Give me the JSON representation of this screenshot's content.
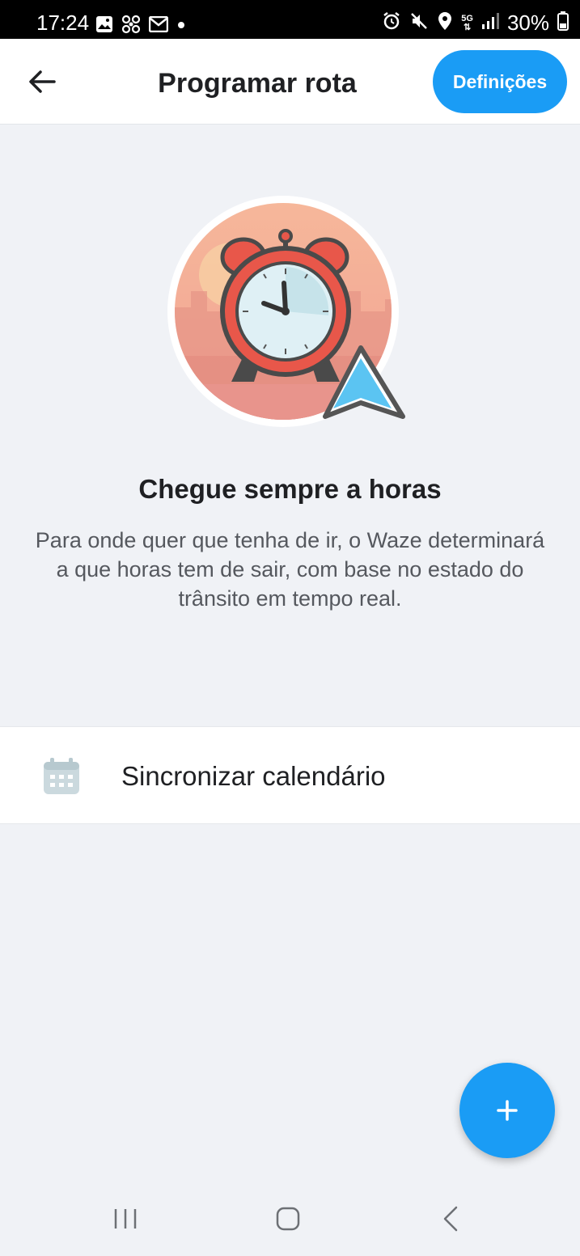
{
  "status_bar": {
    "time": "17:24",
    "battery": "30%",
    "left_icons": [
      "image-icon",
      "fan-icon",
      "mail-icon",
      "dot-icon"
    ],
    "right_icons": [
      "alarm-icon",
      "mute-icon",
      "location-icon",
      "5g-icon",
      "signal-icon",
      "battery-icon"
    ],
    "network_label": "5G"
  },
  "header": {
    "title": "Programar rota",
    "back_icon": "arrow-left-icon",
    "settings_label": "Definições"
  },
  "hero": {
    "illustration": "alarm-clock-navigation-illustration",
    "headline": "Chegue sempre a horas",
    "description": "Para onde quer que tenha de ir, o Waze determinará a que horas tem de sair, com base no estado do trânsito em tempo real."
  },
  "calendar_sync": {
    "icon": "calendar-icon",
    "label": "Sincronizar calendário"
  },
  "fab": {
    "icon": "plus-icon"
  },
  "nav_bar": {
    "recents_icon": "recents-icon",
    "home_icon": "home-icon",
    "back_icon": "back-chevron-icon"
  },
  "colors": {
    "accent": "#1a9cf5",
    "background": "#f0f2f6",
    "clock_red": "#e8574a"
  }
}
